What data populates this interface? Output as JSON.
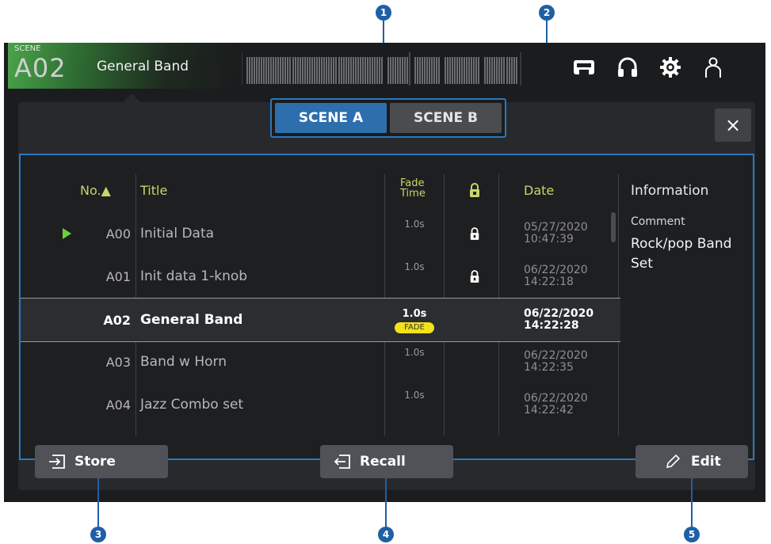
{
  "callouts": [
    "1",
    "2",
    "3",
    "4",
    "5"
  ],
  "header": {
    "scene_label": "SCENE",
    "scene_number": "A02",
    "scene_name": "General Band"
  },
  "tabs": [
    {
      "label": "SCENE A",
      "selected": true
    },
    {
      "label": "SCENE B",
      "selected": false
    }
  ],
  "close_label": "×",
  "columns": {
    "number": "No.▲",
    "title": "Title",
    "fade_line1": "Fade",
    "fade_line2": "Time",
    "date": "Date",
    "information": "Information"
  },
  "scenes": [
    {
      "number": "A00",
      "title": "Initial Data",
      "fade": "1.0s",
      "locked": true,
      "date": "05/27/2020",
      "time": "10:47:39",
      "current": true
    },
    {
      "number": "A01",
      "title": "Init data 1-knob",
      "fade": "1.0s",
      "locked": true,
      "date": "06/22/2020",
      "time": "14:22:18"
    },
    {
      "number": "A02",
      "title": "General Band",
      "fade": "1.0s",
      "locked": false,
      "date": "06/22/2020",
      "time": "14:22:28",
      "selected": true,
      "badge": "FADE"
    },
    {
      "number": "A03",
      "title": "Band w Horn",
      "fade": "1.0s",
      "locked": false,
      "date": "06/22/2020",
      "time": "14:22:35"
    },
    {
      "number": "A04",
      "title": "Jazz Combo set",
      "fade": "1.0s",
      "locked": false,
      "date": "06/22/2020",
      "time": "14:22:42"
    }
  ],
  "information": {
    "comment_label": "Comment",
    "comment_text": "Rock/pop Band Set"
  },
  "buttons": {
    "store": "Store",
    "recall": "Recall",
    "edit": "Edit"
  },
  "colors": {
    "accent_blue": "#2a78c0",
    "tab_selected": "#2d6fad",
    "header_text": "#c9d46a",
    "fade_badge": "#f1e21a",
    "current_marker": "#6fcf3a"
  },
  "icons": [
    "scene-memory-icon",
    "headphones-icon",
    "gear-icon",
    "user-icon",
    "lock-icon",
    "store-icon",
    "recall-icon",
    "pencil-icon",
    "play-marker-icon",
    "sort-ascending-icon"
  ]
}
